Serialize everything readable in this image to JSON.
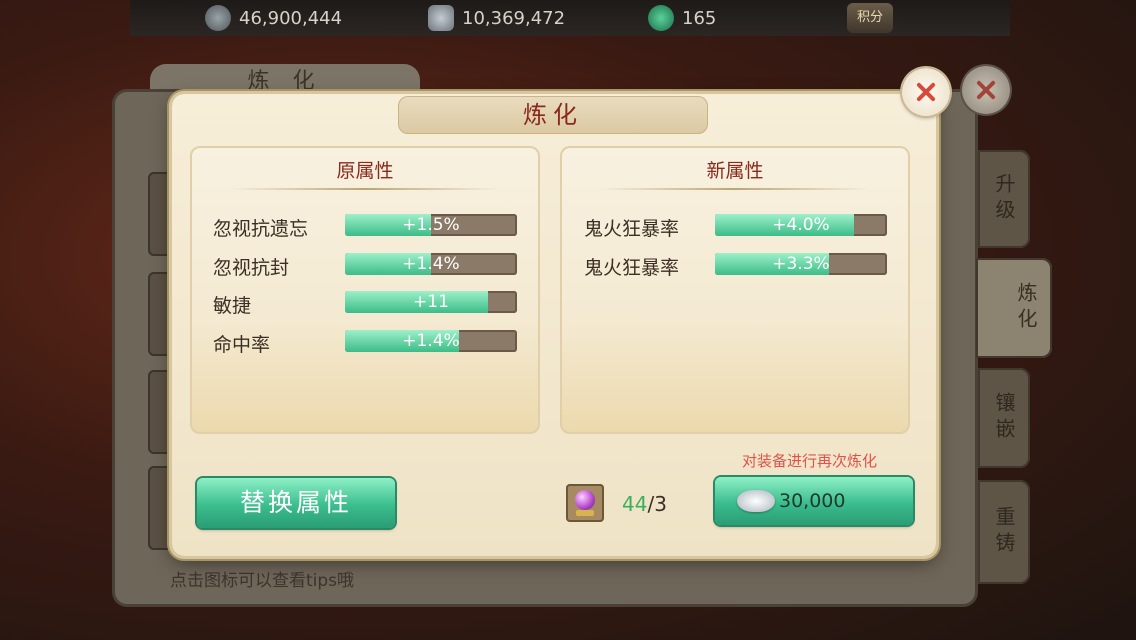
{
  "currency": {
    "silver_coins": "46,900,444",
    "silver_ingots": "10,369,472",
    "jade": "165",
    "score_label": "积分"
  },
  "background": {
    "title": "炼 化",
    "hint": "点击图标可以查看tips哦",
    "tabs": [
      "升级",
      "炼化",
      "镶嵌",
      "重铸"
    ]
  },
  "modal": {
    "title": "炼化",
    "old_attrs": {
      "heading": "原属性",
      "rows": [
        {
          "label": "忽视抗遗忘",
          "value": "+1.5%",
          "fill": 0.5
        },
        {
          "label": "忽视抗封",
          "value": "+1.4%",
          "fill": 0.5
        },
        {
          "label": "敏捷",
          "value": "+11",
          "fill": 0.83
        },
        {
          "label": "命中率",
          "value": "+1.4%",
          "fill": 0.66
        }
      ]
    },
    "new_attrs": {
      "heading": "新属性",
      "rows": [
        {
          "label": "鬼火狂暴率",
          "value": "+4.0%",
          "fill": 0.81
        },
        {
          "label": "鬼火狂暴率",
          "value": "+3.3%",
          "fill": 0.66
        }
      ]
    },
    "replace_button": "替换属性",
    "refine_note": "对装备进行再次炼化",
    "material_have": "44",
    "material_need": "/3",
    "refine_cost": "30,000"
  },
  "colors": {
    "accent_green": "#3cbc88",
    "title_red": "#8a2a1c",
    "note_red": "#e0534a"
  }
}
